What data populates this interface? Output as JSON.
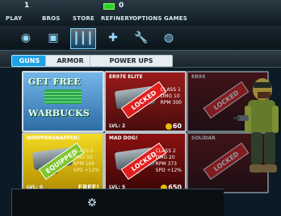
{
  "top": {
    "left_value": "1",
    "right_value": "0",
    "nav": [
      "PLAY",
      "BROS",
      "STORE",
      "REFINERY",
      "OPTIONS",
      "GAMES"
    ]
  },
  "icons": [
    "globe-icon",
    "backpack-icon",
    "ammo-icon",
    "shield-icon",
    "wrench-icon",
    "robot-icon"
  ],
  "tabs": [
    {
      "label": "GUNS",
      "active": true
    },
    {
      "label": "ARMOR",
      "active": false
    },
    {
      "label": "POWER UPS",
      "active": false
    }
  ],
  "cards": [
    {
      "kind": "promo",
      "line1": "GET FREE",
      "line2": "WARBUCKS"
    },
    {
      "kind": "item",
      "name": "ER97E ELITE",
      "stamp": "LOCKED",
      "stats": [
        [
          "CLASS",
          "1"
        ],
        [
          "DMG",
          "10"
        ],
        [
          "RPM",
          "300"
        ]
      ],
      "level": "LVL: 2",
      "price": "60"
    },
    {
      "kind": "partial",
      "name": "ER9X",
      "stamp": "LOCKED"
    },
    {
      "kind": "item",
      "name": "WHIPPERSNAPPER!",
      "stamp": "EQUIPPED",
      "stats": [
        [
          "CLASS",
          "0"
        ],
        [
          "DMG",
          "10"
        ],
        [
          "RPM",
          "169"
        ],
        [
          "SPD",
          "+12%"
        ]
      ],
      "level": "LVL: 0",
      "price": "FREE!"
    },
    {
      "kind": "item",
      "name": "MAD DOG!",
      "stamp": "LOCKED",
      "stats": [
        [
          "CLASS",
          "2"
        ],
        [
          "DMG",
          "20"
        ],
        [
          "RPM",
          "373"
        ],
        [
          "SPD",
          "+12%"
        ]
      ],
      "level": "LVL: 5",
      "price": "650"
    },
    {
      "kind": "partial",
      "name": "SOLIDAR",
      "stamp": "LOCKED"
    }
  ]
}
